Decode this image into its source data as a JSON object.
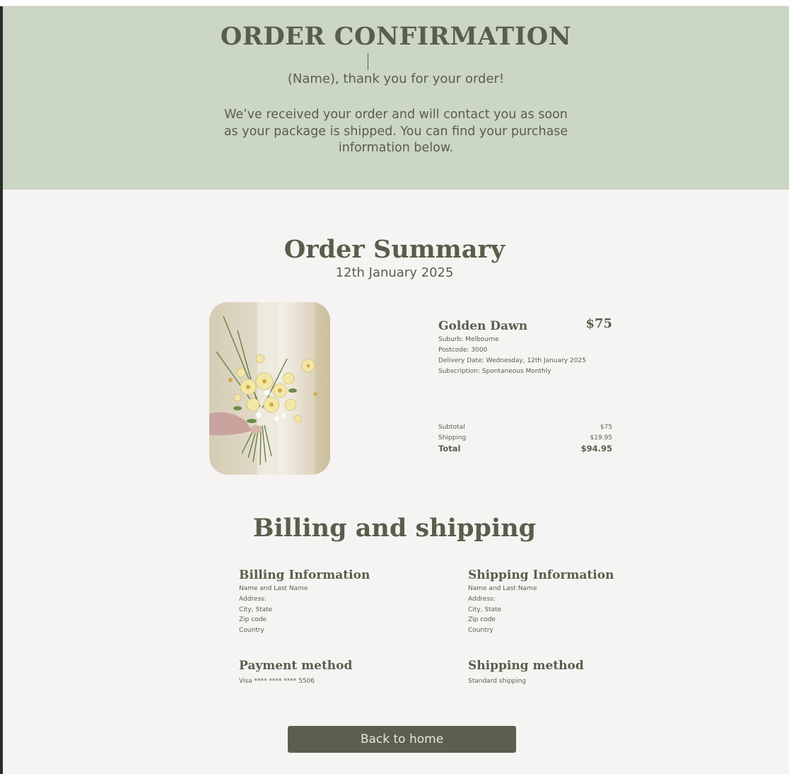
{
  "hero": {
    "title": "ORDER CONFIRMATION",
    "thanks": "(Name), thank you for your order!",
    "message": "We’ve received your order and will contact you as soon as your package is shipped. You can find your purchase information below."
  },
  "summary": {
    "title": "Order Summary",
    "date": "12th January 2025",
    "product": {
      "image_icon": "flower-bouquet-photo",
      "name": "Golden Dawn",
      "price": "$75",
      "details": [
        "Suburb: Melbourne",
        "Postcode: 3000",
        "Delivery Date:  Wednesday, 12th January 2025",
        "Subscription: Spontaneous Monthly"
      ]
    },
    "totals": {
      "subtotal_label": "Subtotal",
      "subtotal_value": "$75",
      "shipping_label": "Shipping",
      "shipping_value": "$19.95",
      "total_label": "Total",
      "total_value": "$94.95"
    }
  },
  "billing": {
    "title": "Billing and shipping",
    "billing_info": {
      "heading": "Billing Information",
      "lines": [
        "Name and Last Name",
        "Address:",
        "City, State",
        "Zip code",
        "Country"
      ]
    },
    "shipping_info": {
      "heading": "Shipping Information",
      "lines": [
        "Name and Last Name",
        "Address:",
        "City, State",
        "Zip code",
        "Country"
      ]
    },
    "payment": {
      "heading": "Payment method",
      "value": "Visa **** **** **** 5506"
    },
    "shipping_method": {
      "heading": "Shipping method",
      "value": "Standard shipping"
    }
  },
  "actions": {
    "back_home_label": "Back to home"
  },
  "colors": {
    "hero_background": "#cbd6c5",
    "page_background": "#f5f4f2",
    "text": "#5a5d4c",
    "button": "#5c5f4e"
  }
}
